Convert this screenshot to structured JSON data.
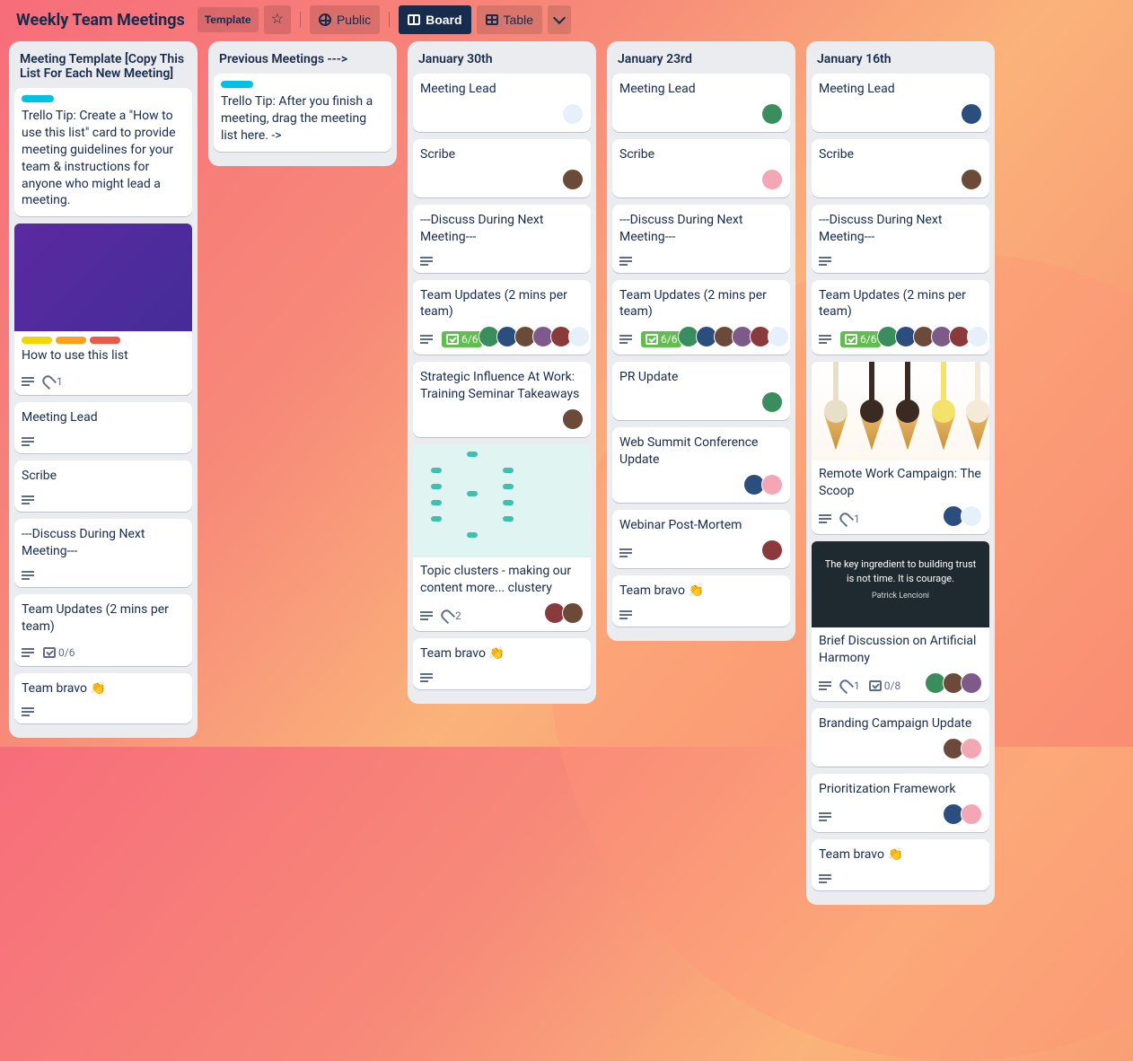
{
  "header": {
    "title": "Weekly Team Meetings",
    "template_label": "Template",
    "public_label": "Public",
    "board_label": "Board",
    "table_label": "Table"
  },
  "avatars": [
    {
      "bg": "#3a8d5c"
    },
    {
      "bg": "#2b4e7e"
    },
    {
      "bg": "#6b4a3a"
    },
    {
      "bg": "#7d5a8a"
    },
    {
      "bg": "#8a3a3a"
    },
    {
      "bg": "#e6f0fa"
    },
    {
      "bg": "#f4a6b4"
    }
  ],
  "lists": [
    {
      "title": "Meeting Template [Copy This List For Each New Meeting]",
      "cards": [
        {
          "stripe": "blue",
          "title": "Trello Tip: Create a \"How to use this list\" card to provide meeting guidelines for your team & instructions for anyone who might lead a meeting."
        },
        {
          "cover": "purple",
          "labels": [
            "yellow",
            "orange",
            "red"
          ],
          "title": "How to use this list",
          "desc": true,
          "attach": "1"
        },
        {
          "title": "Meeting Lead",
          "desc": true
        },
        {
          "title": "Scribe",
          "desc": true
        },
        {
          "title": "---Discuss During Next Meeting---",
          "desc": true
        },
        {
          "title": "Team Updates (2 mins per team)",
          "desc": true,
          "check": "0/6"
        },
        {
          "title": "Team bravo 👏",
          "desc": true
        }
      ]
    },
    {
      "title": "Previous Meetings --->",
      "cards": [
        {
          "stripe": "blue",
          "title": "Trello Tip: After you finish a meeting, drag the meeting list here. ->"
        }
      ]
    },
    {
      "title": "January 30th",
      "cards": [
        {
          "title": "Meeting Lead",
          "member_idx": [
            5
          ]
        },
        {
          "title": "Scribe",
          "member_idx": [
            2
          ]
        },
        {
          "title": "---Discuss During Next Meeting---",
          "desc": true
        },
        {
          "title": "Team Updates (2 mins per team)",
          "desc": true,
          "check_green": "6/6",
          "member_idx": [
            0,
            1,
            2,
            3,
            4,
            5
          ]
        },
        {
          "title": "Strategic Influence At Work: Training Seminar Takeaways",
          "member_idx": [
            2
          ]
        },
        {
          "cover": "teal",
          "title": "Topic clusters - making our content more... clustery",
          "desc": true,
          "attach": "2",
          "member_idx": [
            4,
            2
          ]
        },
        {
          "title": "Team bravo 👏",
          "desc": true
        }
      ]
    },
    {
      "title": "January 23rd",
      "cards": [
        {
          "title": "Meeting Lead",
          "member_idx": [
            0
          ]
        },
        {
          "title": "Scribe",
          "member_idx": [
            6
          ]
        },
        {
          "title": "---Discuss During Next Meeting---",
          "desc": true
        },
        {
          "title": "Team Updates (2 mins per team)",
          "desc": true,
          "check_green": "6/6",
          "member_idx": [
            0,
            1,
            2,
            3,
            4,
            5
          ]
        },
        {
          "title": "PR Update",
          "member_idx": [
            0
          ]
        },
        {
          "title": "Web Summit Conference Update",
          "member_idx": [
            1,
            6
          ]
        },
        {
          "title": "Webinar Post-Mortem",
          "desc": true,
          "member_idx": [
            4
          ]
        },
        {
          "title": "Team bravo 👏",
          "desc": true
        }
      ]
    },
    {
      "title": "January 16th",
      "cards": [
        {
          "title": "Meeting Lead",
          "member_idx": [
            1
          ]
        },
        {
          "title": "Scribe",
          "member_idx": [
            2
          ]
        },
        {
          "title": "---Discuss During Next Meeting---",
          "desc": true
        },
        {
          "title": "Team Updates (2 mins per team)",
          "desc": true,
          "check_green": "6/6",
          "member_idx": [
            0,
            1,
            2,
            3,
            4,
            5
          ]
        },
        {
          "cover": "cone",
          "title": "Remote Work Campaign: The Scoop",
          "desc": true,
          "attach": "1",
          "member_idx": [
            1,
            5
          ]
        },
        {
          "cover": "dark",
          "quote": "The key ingredient to building trust is not time. It is courage.",
          "quote_author": "Patrick Lencioni",
          "title": "Brief Discussion on Artificial Harmony",
          "desc": true,
          "attach": "1",
          "check": "0/8",
          "member_idx": [
            0,
            2,
            3
          ]
        },
        {
          "title": "Branding Campaign Update",
          "member_idx": [
            2,
            6
          ]
        },
        {
          "title": "Prioritization Framework",
          "desc": true,
          "member_idx": [
            1,
            6
          ]
        },
        {
          "title": "Team bravo 👏",
          "desc": true
        }
      ]
    }
  ]
}
